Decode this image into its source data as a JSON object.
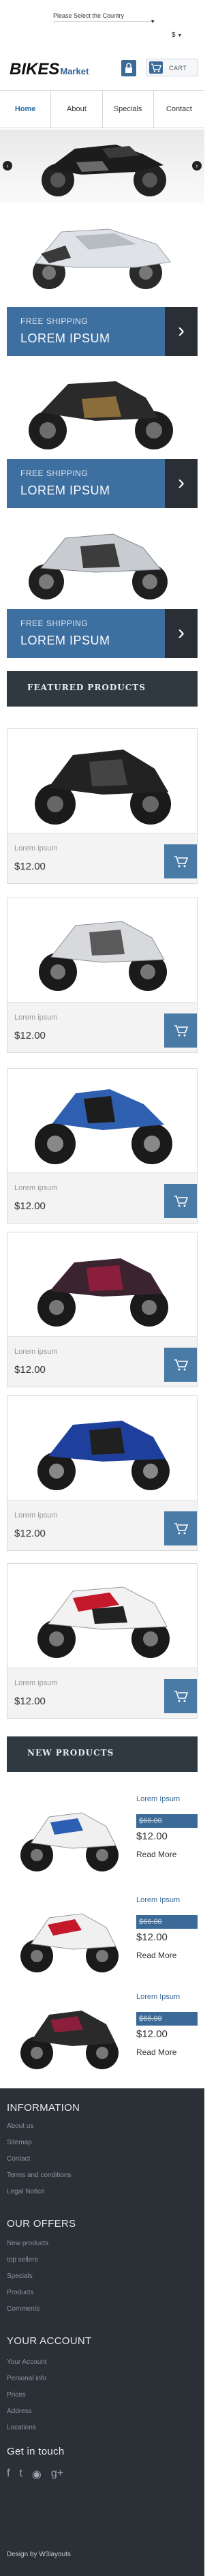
{
  "header": {
    "country_select": "Please Select the Country",
    "currency": "$",
    "logo_main": "BIKES",
    "logo_sub": "Market",
    "cart_label": "CART"
  },
  "nav": [
    "Home",
    "About",
    "Specials",
    "Contact"
  ],
  "banners": [
    {
      "line1": "FREE SHIPPING",
      "line2": "LOREM IPSUM"
    },
    {
      "line1": "FREE SHIPPING",
      "line2": "LOREM IPSUM"
    },
    {
      "line1": "FREE SHIPPING",
      "line2": "LOREM IPSUM"
    }
  ],
  "featured": {
    "title": "FEATURED PRODUCTS",
    "products": [
      {
        "name": "Lorem ipsum",
        "price": "$12.00"
      },
      {
        "name": "Lorem ipsum",
        "price": "$12.00"
      },
      {
        "name": "Lorem ipsum",
        "price": "$12.00"
      },
      {
        "name": "Lorem ipsum",
        "price": "$12.00"
      },
      {
        "name": "Lorem ipsum",
        "price": "$12.00"
      },
      {
        "name": "Lorem ipsum",
        "price": "$12.00"
      }
    ]
  },
  "new_products": {
    "title": "NEW PRODUCTS",
    "items": [
      {
        "name": "Lorem Ipsum",
        "old_price": "$66.00",
        "price": "$12.00",
        "more": "Read More"
      },
      {
        "name": "Lorem Ipsum",
        "old_price": "$66.00",
        "price": "$12.00",
        "more": "Read More"
      },
      {
        "name": "Lorem Ipsum",
        "old_price": "$66.00",
        "price": "$12.00",
        "more": "Read More"
      }
    ]
  },
  "footer": {
    "information_title": "INFORMATION",
    "information_links": [
      "About us",
      "Sitemap",
      "Contact",
      "Terms and conditions",
      "Legal Notice"
    ],
    "offers_title": "OUR OFFERS",
    "offers_links": [
      "New products",
      "top sellers",
      "Specials",
      "Products",
      "Comments"
    ],
    "account_title": "YOUR ACCOUNT",
    "account_links": [
      "Your Account",
      "Personal info",
      "Prices",
      "Address",
      "Locations"
    ],
    "contact_title": "Get in touch",
    "design": "Design by W3layouts"
  },
  "colors": {
    "accent": "#3b6a98",
    "dark": "#2b2f36",
    "banner": "#3d6fa0"
  }
}
